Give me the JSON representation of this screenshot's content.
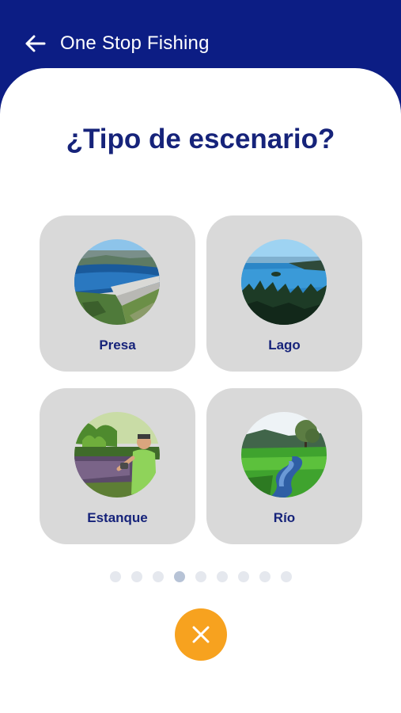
{
  "header": {
    "title": "One Stop Fishing",
    "back_icon": "arrow-left-icon"
  },
  "question": "¿Tipo de escenario?",
  "options": [
    {
      "label": "Presa",
      "image": "dam-photo"
    },
    {
      "label": "Lago",
      "image": "lake-photo"
    },
    {
      "label": "Estanque",
      "image": "pond-angler-photo"
    },
    {
      "label": "Río",
      "image": "river-photo"
    }
  ],
  "pagination": {
    "total": 9,
    "current": 4
  },
  "close_button": {
    "icon": "close-icon"
  },
  "colors": {
    "header": "#0c1d84",
    "title_text": "#16237a",
    "card_bg": "#d9d9d9",
    "accent": "#f7a21f",
    "dot_inactive": "#e5e8ee",
    "dot_active": "#b7c3d6"
  }
}
